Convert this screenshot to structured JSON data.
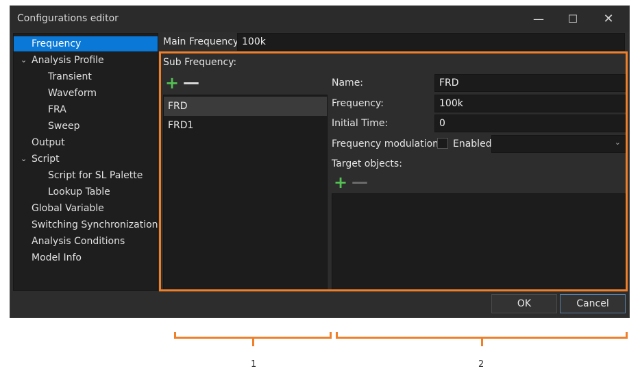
{
  "window": {
    "title": "Configurations editor",
    "controls": {
      "minimize": "—",
      "maximize": "☐",
      "close": "✕"
    }
  },
  "tree": {
    "items": [
      {
        "label": "Frequency",
        "level": 0,
        "expander": "",
        "selected": true
      },
      {
        "label": "Analysis Profile",
        "level": 0,
        "expander": "⌄"
      },
      {
        "label": "Transient",
        "level": 1
      },
      {
        "label": "Waveform",
        "level": 1
      },
      {
        "label": "FRA",
        "level": 1
      },
      {
        "label": "Sweep",
        "level": 1
      },
      {
        "label": "Output",
        "level": 0
      },
      {
        "label": "Script",
        "level": 0,
        "expander": "⌄"
      },
      {
        "label": "Script for SL Palette",
        "level": 1
      },
      {
        "label": "Lookup Table",
        "level": 1
      },
      {
        "label": "Global Variable",
        "level": 0
      },
      {
        "label": "Switching Synchronization",
        "level": 0
      },
      {
        "label": "Analysis Conditions",
        "level": 0
      },
      {
        "label": "Model Info",
        "level": 0
      }
    ]
  },
  "main_frequency": {
    "label": "Main Frequency:",
    "value": "100k"
  },
  "sub_frequency": {
    "label": "Sub Frequency:",
    "add_icon": "+",
    "remove_icon": "—",
    "list": [
      {
        "label": "FRD",
        "selected": true
      },
      {
        "label": "FRD1"
      }
    ]
  },
  "details": {
    "name_label": "Name:",
    "name_value": "FRD",
    "frequency_label": "Frequency:",
    "frequency_value": "100k",
    "initial_time_label": "Initial Time:",
    "initial_time_value": "0",
    "modulation_label": "Frequency modulation:",
    "enabled_label": "Enabled",
    "combo_chevron": "⌄",
    "target_label": "Target objects:",
    "target_add_icon": "+",
    "target_remove_icon": "—"
  },
  "buttons": {
    "ok": "OK",
    "cancel": "Cancel"
  },
  "annotations": {
    "caption_1": "1",
    "caption_2": "2"
  },
  "colors": {
    "highlight": "#f07f2a",
    "selection": "#0a78d7",
    "add": "#53c153"
  }
}
